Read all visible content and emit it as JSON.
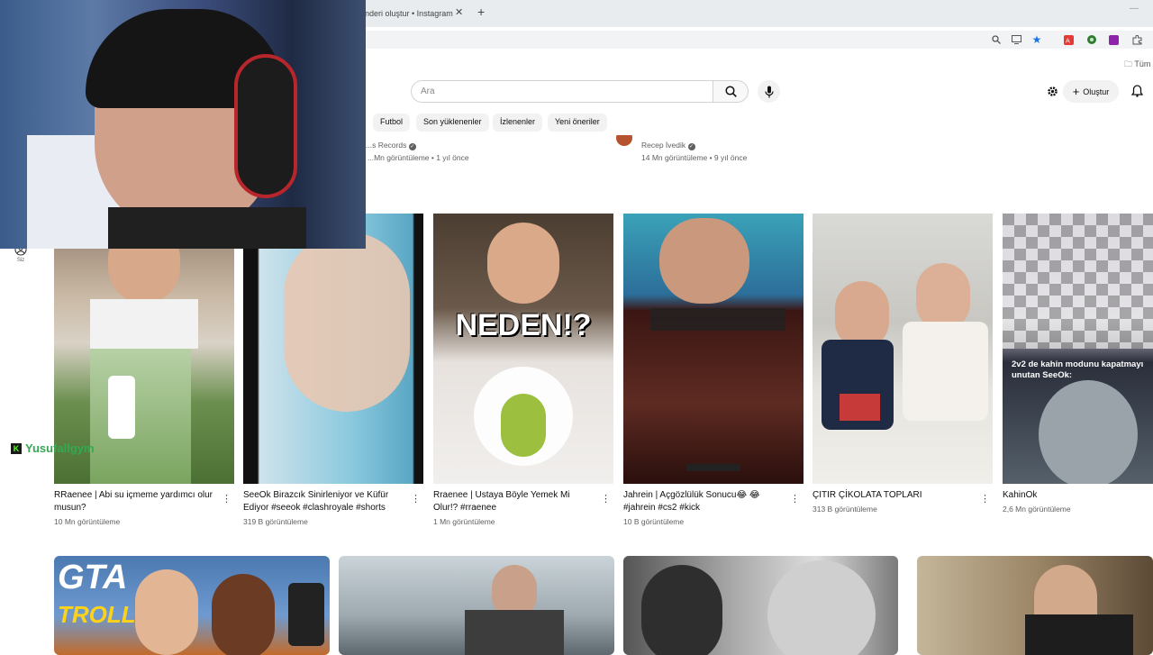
{
  "browser": {
    "tab_title": "önderi oluştur • Instagram",
    "tab_close": "✕",
    "tab_new": "+",
    "bookmark_folder": "Tüm"
  },
  "masthead": {
    "search_placeholder": "Ara",
    "create_label": "Oluştur"
  },
  "chips": [
    "Futbol",
    "Son yüklenenler",
    "İzlenenler",
    "Yeni öneriler"
  ],
  "top_row": [
    {
      "channel": "...s Records",
      "meta": "...Mn görüntüleme • 1 yıl önce"
    },
    {
      "channel": "Recep İvedik",
      "meta": "14 Mn görüntüleme • 9 yıl önce"
    }
  ],
  "sidebar": {
    "you_label": "Siz"
  },
  "shorts": [
    {
      "title": "RRaenee | Abi su içmeme yardımcı olur musun?",
      "views": "10 Mn görüntüleme"
    },
    {
      "title": "SeeOk Birazcık Sinirleniyor ve Küfür Ediyor #seeok #clashroyale #shorts",
      "views": "319 B görüntüleme"
    },
    {
      "title": "Rraenee | Ustaya Böyle Yemek Mi Olur!? #rraenee",
      "views": "1 Mn görüntüleme",
      "overlay": "NEDEN!?"
    },
    {
      "title": "Jahrein | Açgözlülük Sonucu😂 😂 #jahrein #cs2 #kick",
      "views": "10 B görüntüleme"
    },
    {
      "title": "ÇITIR ÇİKOLATA TOPLARI",
      "views": "313 B görüntüleme"
    },
    {
      "title": "KahinOk",
      "views": "2,6 Mn görüntüleme",
      "overlay": "2v2 de kahin modunu kapatmayı unutan SeeOk:"
    }
  ],
  "bottom_row": [
    {
      "overlay_line1": "GTA",
      "overlay_line2": "TROLL"
    }
  ],
  "webcam": {
    "streamer_name": "Yusufallgym"
  },
  "colors": {
    "accent_green": "#34a853",
    "yt_red": "#ff0000"
  }
}
